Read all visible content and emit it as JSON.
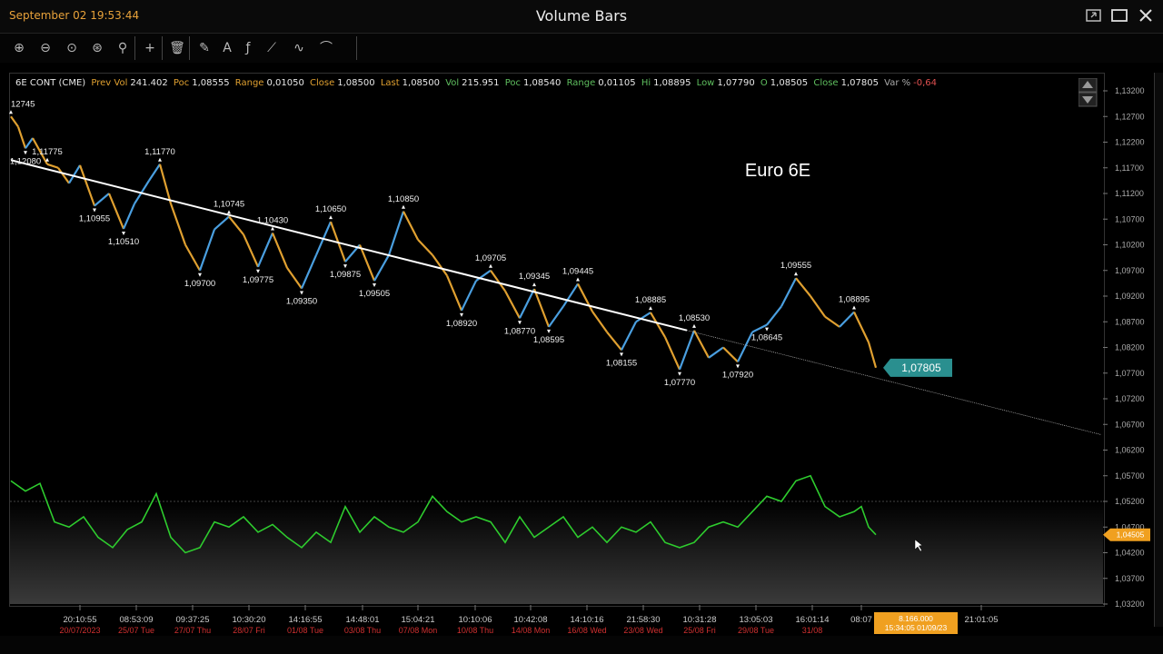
{
  "window": {
    "datetime": "September 02 19:53:44",
    "title": "Volume Bars"
  },
  "toolbar": {
    "tools": [
      "zoom-in-icon",
      "zoom-out-icon",
      "zoom-fit-icon",
      "zoom-auto-icon",
      "zoom-fx-icon",
      "crosshair-icon",
      "trash-icon",
      "pencil-icon",
      "text-tool-icon",
      "fx-icon",
      "lines-tool-icon",
      "wave-tool-icon",
      "fib-tool-icon"
    ]
  },
  "header": {
    "symbol": "6E CONT (CME)",
    "prev_vol_label": "Prev Vol",
    "prev_vol": "241.402",
    "poc1_label": "Poc",
    "poc1": "1,08555",
    "range1_label": "Range",
    "range1": "0,01050",
    "close1_label": "Close",
    "close1": "1,08500",
    "last_label": "Last",
    "last": "1,08500",
    "vol_label": "Vol",
    "vol": "215.951",
    "poc2_label": "Poc",
    "poc2": "1,08540",
    "range2_label": "Range",
    "range2": "0,01105",
    "hi_label": "Hi",
    "hi": "1,08895",
    "low_label": "Low",
    "low": "1,07790",
    "o_label": "O",
    "o": "1,08505",
    "close2_label": "Close",
    "close2": "1,07805",
    "var_label": "Var %",
    "var": "-0,64"
  },
  "chart_data": {
    "type": "line",
    "title": "Euro 6E",
    "y_axis_ticks": [
      "1,13200",
      "1,12700",
      "1,12200",
      "1,11700",
      "1,11200",
      "1,10700",
      "1,10200",
      "1,09700",
      "1,09200",
      "1,08700",
      "1,08200",
      "1,07700",
      "1,07200",
      "1,06700",
      "1,06200",
      "1,05700",
      "1,05200",
      "1,04700",
      "1,04200",
      "1,03700",
      "1,03200"
    ],
    "ylim": [
      1.032,
      1.132
    ],
    "price_series": {
      "name": "",
      "points": [
        [
          0,
          1.127
        ],
        [
          2,
          1.125
        ],
        [
          4,
          1.1208
        ],
        [
          6,
          1.1228
        ],
        [
          10,
          1.1177
        ],
        [
          13,
          1.117
        ],
        [
          16,
          1.114
        ],
        [
          19,
          1.1175
        ],
        [
          23,
          1.1096
        ],
        [
          27,
          1.112
        ],
        [
          31,
          1.1051
        ],
        [
          34,
          1.11
        ],
        [
          38,
          1.1145
        ],
        [
          41,
          1.1177
        ],
        [
          44,
          1.11
        ],
        [
          48,
          1.102
        ],
        [
          52,
          1.097
        ],
        [
          56,
          1.105
        ],
        [
          60,
          1.1075
        ],
        [
          64,
          1.104
        ],
        [
          68,
          1.0977
        ],
        [
          72,
          1.1043
        ],
        [
          76,
          1.0975
        ],
        [
          80,
          1.0935
        ],
        [
          84,
          1.1
        ],
        [
          88,
          1.1065
        ],
        [
          92,
          1.0987
        ],
        [
          96,
          1.102
        ],
        [
          100,
          1.095
        ],
        [
          104,
          1.1
        ],
        [
          108,
          1.1085
        ],
        [
          112,
          1.103
        ],
        [
          116,
          1.1
        ],
        [
          120,
          1.096
        ],
        [
          124,
          1.0892
        ],
        [
          128,
          1.095
        ],
        [
          132,
          1.097
        ],
        [
          136,
          1.093
        ],
        [
          140,
          1.0877
        ],
        [
          144,
          1.0934
        ],
        [
          148,
          1.086
        ],
        [
          152,
          1.09
        ],
        [
          156,
          1.0944
        ],
        [
          160,
          1.089
        ],
        [
          164,
          1.085
        ],
        [
          168,
          1.0815
        ],
        [
          172,
          1.087
        ],
        [
          176,
          1.0888
        ],
        [
          180,
          1.084
        ],
        [
          184,
          1.0777
        ],
        [
          188,
          1.0853
        ],
        [
          192,
          1.08
        ],
        [
          196,
          1.082
        ],
        [
          200,
          1.0792
        ],
        [
          204,
          1.085
        ],
        [
          208,
          1.0864
        ],
        [
          212,
          1.09
        ],
        [
          216,
          1.0955
        ],
        [
          220,
          1.092
        ],
        [
          224,
          1.088
        ],
        [
          228,
          1.086
        ],
        [
          232,
          1.0889
        ],
        [
          236,
          1.083
        ],
        [
          238,
          1.07805
        ]
      ],
      "pivot_labels": [
        {
          "i": 0,
          "v": 1.127,
          "text": "12745",
          "pos": "above"
        },
        {
          "i": 4,
          "v": 1.1208,
          "text": "1,12080",
          "pos": "below"
        },
        {
          "i": 10,
          "v": 1.1177,
          "text": "1,11775",
          "pos": "above"
        },
        {
          "i": 23,
          "v": 1.1096,
          "text": "1,10955",
          "pos": "below"
        },
        {
          "i": 31,
          "v": 1.1051,
          "text": "1,10510",
          "pos": "below"
        },
        {
          "i": 41,
          "v": 1.1177,
          "text": "1,11770",
          "pos": "above"
        },
        {
          "i": 52,
          "v": 1.097,
          "text": "1,09700",
          "pos": "below"
        },
        {
          "i": 60,
          "v": 1.1075,
          "text": "1,10745",
          "pos": "above"
        },
        {
          "i": 68,
          "v": 1.0977,
          "text": "1,09775",
          "pos": "below"
        },
        {
          "i": 72,
          "v": 1.1043,
          "text": "1,10430",
          "pos": "above"
        },
        {
          "i": 80,
          "v": 1.0935,
          "text": "1,09350",
          "pos": "below"
        },
        {
          "i": 88,
          "v": 1.1065,
          "text": "1,10650",
          "pos": "above"
        },
        {
          "i": 92,
          "v": 1.0987,
          "text": "1,09875",
          "pos": "below"
        },
        {
          "i": 100,
          "v": 1.095,
          "text": "1,09505",
          "pos": "below"
        },
        {
          "i": 108,
          "v": 1.1085,
          "text": "1,10850",
          "pos": "above"
        },
        {
          "i": 124,
          "v": 1.0892,
          "text": "1,08920",
          "pos": "below"
        },
        {
          "i": 132,
          "v": 1.097,
          "text": "1,09705",
          "pos": "above"
        },
        {
          "i": 140,
          "v": 1.0877,
          "text": "1,08770",
          "pos": "below"
        },
        {
          "i": 144,
          "v": 1.0934,
          "text": "1,09345",
          "pos": "above"
        },
        {
          "i": 148,
          "v": 1.086,
          "text": "1,08595",
          "pos": "below"
        },
        {
          "i": 156,
          "v": 1.0944,
          "text": "1,09445",
          "pos": "above"
        },
        {
          "i": 168,
          "v": 1.0815,
          "text": "1,08155",
          "pos": "below"
        },
        {
          "i": 176,
          "v": 1.0888,
          "text": "1,08885",
          "pos": "above"
        },
        {
          "i": 184,
          "v": 1.0777,
          "text": "1,07770",
          "pos": "below"
        },
        {
          "i": 188,
          "v": 1.0853,
          "text": "1,08530",
          "pos": "above"
        },
        {
          "i": 200,
          "v": 1.0792,
          "text": "1,07920",
          "pos": "below"
        },
        {
          "i": 208,
          "v": 1.0864,
          "text": "1,08645",
          "pos": "below"
        },
        {
          "i": 216,
          "v": 1.0955,
          "text": "1,09555",
          "pos": "above"
        },
        {
          "i": 232,
          "v": 1.0889,
          "text": "1,08895",
          "pos": "above"
        }
      ]
    },
    "trendline": {
      "start": [
        0,
        1.1185
      ],
      "end": [
        300,
        1.065
      ],
      "solid_until": 186
    },
    "last_price_label": "1,07805",
    "oscillator": {
      "name": "",
      "color": "#2ecc2e",
      "reference_level": 1.052,
      "points": [
        [
          0,
          1.056
        ],
        [
          4,
          1.054
        ],
        [
          8,
          1.0555
        ],
        [
          12,
          1.048
        ],
        [
          16,
          1.047
        ],
        [
          20,
          1.049
        ],
        [
          24,
          1.045
        ],
        [
          28,
          1.043
        ],
        [
          32,
          1.0465
        ],
        [
          36,
          1.048
        ],
        [
          40,
          1.0535
        ],
        [
          44,
          1.045
        ],
        [
          48,
          1.042
        ],
        [
          52,
          1.043
        ],
        [
          56,
          1.048
        ],
        [
          60,
          1.047
        ],
        [
          64,
          1.049
        ],
        [
          68,
          1.046
        ],
        [
          72,
          1.0475
        ],
        [
          76,
          1.045
        ],
        [
          80,
          1.043
        ],
        [
          84,
          1.046
        ],
        [
          88,
          1.044
        ],
        [
          92,
          1.051
        ],
        [
          96,
          1.046
        ],
        [
          100,
          1.049
        ],
        [
          104,
          1.047
        ],
        [
          108,
          1.046
        ],
        [
          112,
          1.048
        ],
        [
          116,
          1.053
        ],
        [
          120,
          1.05
        ],
        [
          124,
          1.048
        ],
        [
          128,
          1.049
        ],
        [
          132,
          1.048
        ],
        [
          136,
          1.044
        ],
        [
          140,
          1.049
        ],
        [
          144,
          1.045
        ],
        [
          148,
          1.047
        ],
        [
          152,
          1.049
        ],
        [
          156,
          1.045
        ],
        [
          160,
          1.047
        ],
        [
          164,
          1.044
        ],
        [
          168,
          1.047
        ],
        [
          172,
          1.046
        ],
        [
          176,
          1.048
        ],
        [
          180,
          1.044
        ],
        [
          184,
          1.043
        ],
        [
          188,
          1.044
        ],
        [
          192,
          1.047
        ],
        [
          196,
          1.048
        ],
        [
          200,
          1.047
        ],
        [
          204,
          1.05
        ],
        [
          208,
          1.053
        ],
        [
          212,
          1.052
        ],
        [
          216,
          1.056
        ],
        [
          220,
          1.057
        ],
        [
          224,
          1.051
        ],
        [
          228,
          1.049
        ],
        [
          232,
          1.05
        ],
        [
          234,
          1.051
        ],
        [
          236,
          1.047
        ],
        [
          238,
          1.0455
        ]
      ],
      "last_label": "1,04505"
    },
    "x_axis_times": [
      "20:10:55",
      "08:53:09",
      "09:37:25",
      "10:30:20",
      "14:16:55",
      "14:48:01",
      "15:04:21",
      "10:10:06",
      "10:42:08",
      "14:10:16",
      "21:58:30",
      "10:31:28",
      "13:05:03",
      "16:01:14",
      "08:07",
      "21:01:05"
    ],
    "x_axis_dates": [
      "20/07/2023",
      "25/07 Tue",
      "27/07 Thu",
      "28/07 Fri",
      "01/08 Tue",
      "03/08 Thu",
      "07/08 Mon",
      "10/08 Thu",
      "14/08 Mon",
      "16/08 Wed",
      "23/08 Wed",
      "25/08 Fri",
      "29/08 Tue",
      "31/08",
      ""
    ],
    "cursor_value": "8.166.000",
    "cursor_date": "15:34:05 01/09/23",
    "colors": {
      "up_bar": "#4a9fe0",
      "down_bar": "#e0a030",
      "trendline": "#ffffff",
      "label_box": "#2a8f8f",
      "cursor_box": "#f0a020",
      "date_red": "#d03030"
    }
  }
}
